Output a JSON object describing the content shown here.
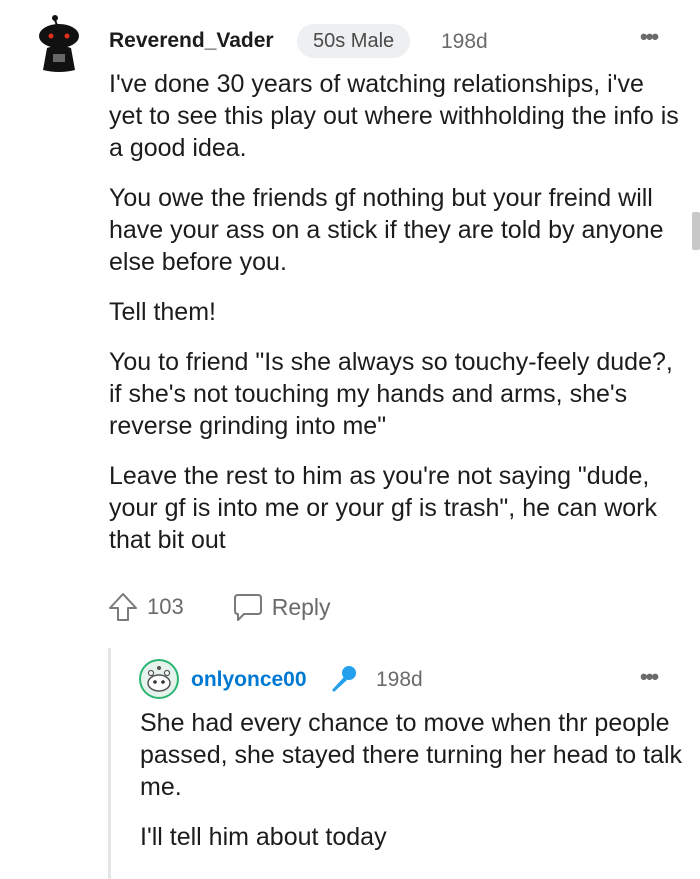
{
  "comment": {
    "author": "Reverend_Vader",
    "flair": "50s Male",
    "age": "198d",
    "more": "•••",
    "paragraphs": [
      "I've done 30 years of watching relationships, i've yet to see this play out where withholding the info is a good idea.",
      "You owe the friends gf nothing but your freind will have your ass on a stick if they are told by anyone else before you.",
      "Tell them!",
      "You to friend \"Is she always so touchy-feely dude?, if she's not touching my hands and arms, she's reverse grinding into me\"",
      "Leave the rest to him as you're not saying \"dude, your gf is into me or your gf is trash\", he can work that bit out"
    ],
    "upvotes": "103",
    "reply_label": "Reply"
  },
  "reply": {
    "author": "onlyonce00",
    "age": "198d",
    "more": "•••",
    "paragraphs": [
      "She had every chance to move when thr people passed, she stayed there turning her head to talk me.",
      "I'll tell him about today"
    ]
  },
  "colors": {
    "reply_author": "#0079d3",
    "mod_icon": "#24a0ed",
    "avatar_eyes": "#e0301e"
  }
}
